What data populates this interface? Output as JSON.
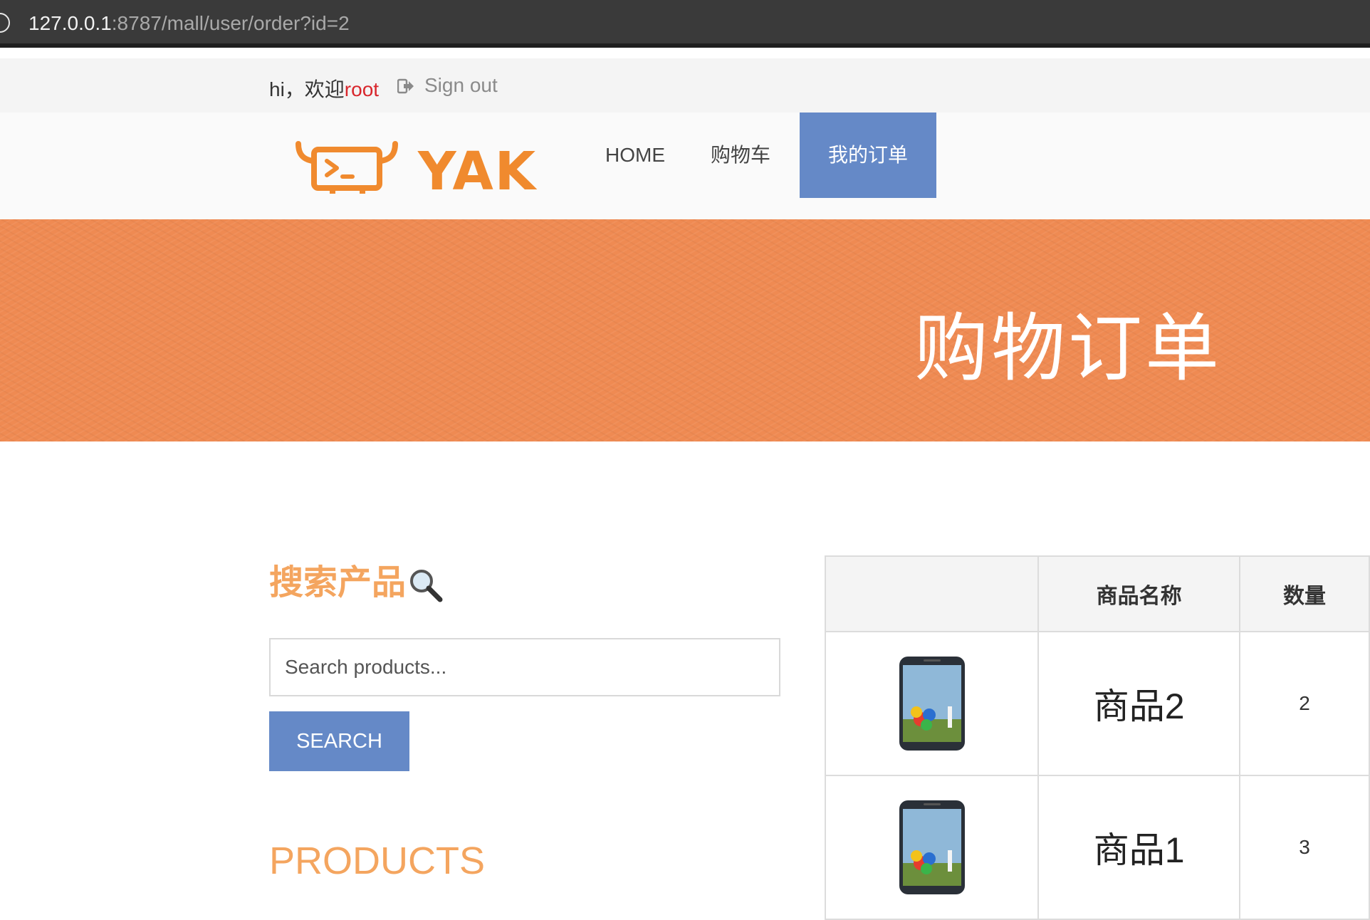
{
  "browser": {
    "url_host": "127.0.0.1",
    "url_rest": ":8787/mall/user/order?id=2"
  },
  "userbar": {
    "greeting": "hi，欢迎",
    "username": "root",
    "signout_label": "Sign out"
  },
  "logo": {
    "text": "YAK"
  },
  "nav": {
    "items": [
      {
        "label": "HOME"
      },
      {
        "label": "购物车"
      },
      {
        "label": "我的订单",
        "active": true
      }
    ],
    "active_color": "#6589c7"
  },
  "banner": {
    "title": "购物订单",
    "color": "#ef8a52"
  },
  "sidebar": {
    "search_title": "搜索产品",
    "search_icon": "magnifier-icon",
    "search_placeholder": "Search products...",
    "search_button": "SEARCH",
    "products_title": "PRODUCTS",
    "accent_color": "#f4a55f"
  },
  "order_table": {
    "headers": [
      "",
      "商品名称",
      "数量"
    ],
    "rows": [
      {
        "image": "phone-image",
        "name": "商品2",
        "qty": "2"
      },
      {
        "image": "phone-image",
        "name": "商品1",
        "qty": "3"
      }
    ]
  }
}
